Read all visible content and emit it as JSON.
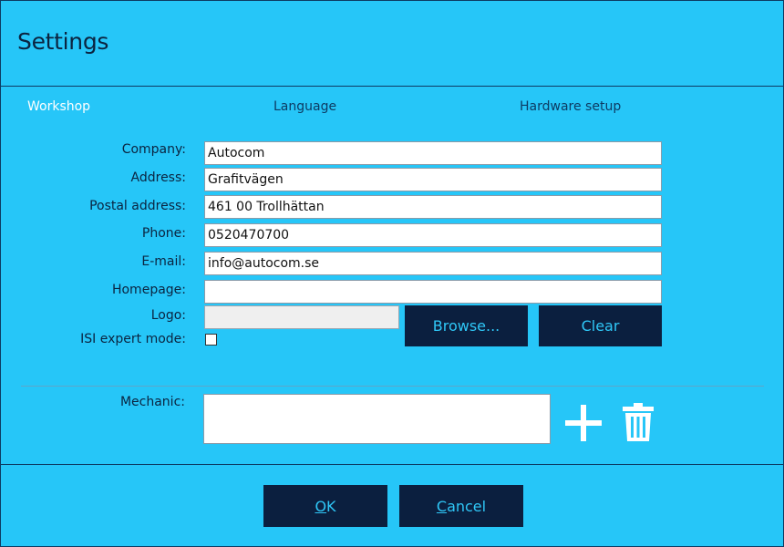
{
  "dialog": {
    "title": "Settings"
  },
  "tabs": [
    {
      "label": "Workshop",
      "active": true
    },
    {
      "label": "Language",
      "active": false
    },
    {
      "label": "Hardware setup",
      "active": false
    }
  ],
  "form": {
    "company": {
      "label": "Company:",
      "value": "Autocom"
    },
    "address": {
      "label": "Address:",
      "value": "Grafitvägen"
    },
    "postal": {
      "label": "Postal address:",
      "value": "461 00 Trollhättan"
    },
    "phone": {
      "label": "Phone:",
      "value": "0520470700"
    },
    "email": {
      "label": "E-mail:",
      "value": "info@autocom.se"
    },
    "homepage": {
      "label": "Homepage:",
      "value": ""
    },
    "logo": {
      "label": "Logo:",
      "value": ""
    },
    "isi": {
      "label": "ISI expert mode:",
      "checked": false
    },
    "browse_label": "Browse...",
    "clear_label": "Clear"
  },
  "mechanic": {
    "label": "Mechanic:",
    "add_icon": "plus-icon",
    "delete_icon": "trash-icon"
  },
  "footer": {
    "ok_first": "O",
    "ok_rest": "K",
    "cancel_first": "C",
    "cancel_rest": "ancel"
  },
  "colors": {
    "background": "#26c6f8",
    "button": "#0b1f3f",
    "button_text": "#2fc7f7",
    "active_tab": "#ffffff"
  }
}
